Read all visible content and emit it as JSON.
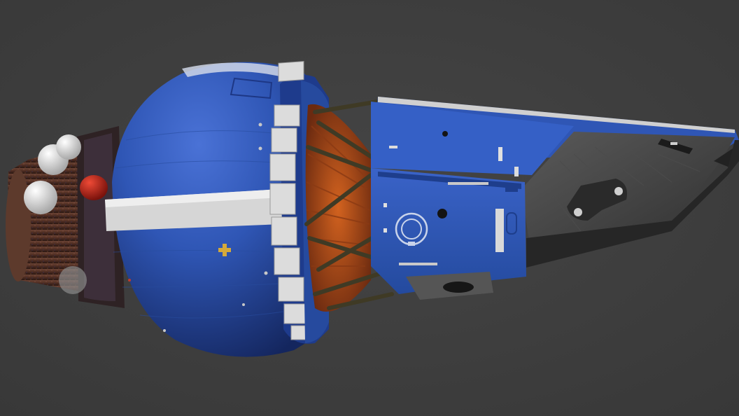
{
  "scene": {
    "subject": "spacecraft-render",
    "colors": {
      "background": "#3d3d3d",
      "hull_blue": "#2f56b5",
      "hull_blue_dark": "#1d3785",
      "stripe_white": "#d9d9d9",
      "rust_brown": "#5a3427",
      "red_light": "#c8241a",
      "truss": "#45402c",
      "engine_orange": "#b24a1c",
      "panel_grey": "#6c6c6c",
      "marker_yellow": "#d4a93b"
    }
  }
}
